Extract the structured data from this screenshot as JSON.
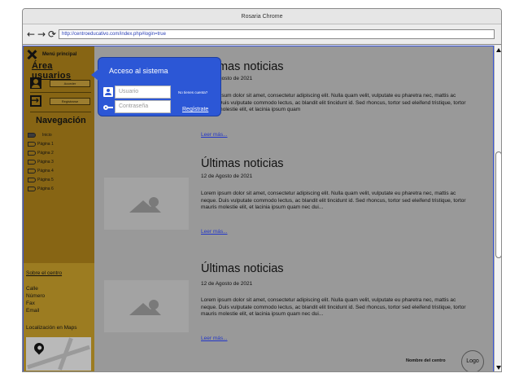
{
  "window": {
    "title": "Rosaria Chrome"
  },
  "browser": {
    "back_icon": "←",
    "forward_icon": "→",
    "reload_icon": "⟳",
    "url": "http://centroeducativo.com/index.php#login=true"
  },
  "sidebar": {
    "menu_label": "Menú principal",
    "area_title": "Área usuarios",
    "access_button": "Acceder",
    "register_button": "Registrarse",
    "nav_title": "Navegación",
    "nav_items": [
      "Inicio",
      "Página 1",
      "Página 2",
      "Página 3",
      "Página 4",
      "Página 5",
      "Página 6"
    ],
    "about_link": "Sobre el centro",
    "contact": [
      "Calle",
      "Número",
      "Fax",
      "Email"
    ],
    "maps_label": "Localización en Maps"
  },
  "articles": [
    {
      "title": "Últimas noticias",
      "date": "12 de Agosto de 2021",
      "body": "Lorem ipsum dolor sit amet, consectetur adipiscing elit. Nulla quam velit, vulputate eu pharetra nec, mattis ac neque. Duis vulputate commodo lectus, ac blandit elit tincidunt id. Sed rhoncus, tortor sed eleifend tristique, tortor mauris molestie elit, et lacinia ipsum quam",
      "link": "Leer más..."
    },
    {
      "title": "Últimas noticias",
      "date": "12 de Agosto de 2021",
      "body": "Lorem ipsum dolor sit amet, consectetur adipiscing elit. Nulla quam velit, vulputate eu pharetra nec, mattis ac neque. Duis vulputate commodo lectus, ac blandit elit tincidunt id. Sed rhoncus, tortor sed eleifend tristique, tortor mauris molestie elit, et lacinia ipsum quam nec dui...",
      "link": "Leer más..."
    },
    {
      "title": "Últimas noticias",
      "date": "12 de Agosto de 2021",
      "body": "Lorem ipsum dolor sit amet, consectetur adipiscing elit. Nulla quam velit, vulputate eu pharetra nec, mattis ac neque. Duis vulputate commodo lectus, ac blandit elit tincidunt id. Sed rhoncus, tortor sed eleifend tristique, tortor mauris molestie elit, et lacinia ipsum quam nec dui...",
      "link": "Leer más..."
    }
  ],
  "footer": {
    "center_name": "Nombre del centro",
    "logo": "Logo"
  },
  "login_popup": {
    "title": "Acceso al sistema",
    "username_placeholder": "Usuario",
    "password_placeholder": "Contraseña",
    "no_account": "No tienes cuenta?",
    "register_link": "Regístrate"
  },
  "colors": {
    "sidebar": "#876514",
    "sidebar_lower": "#9c7c21",
    "overlay": "#999999",
    "popup": "#2c57d6",
    "link": "#2236c8"
  }
}
